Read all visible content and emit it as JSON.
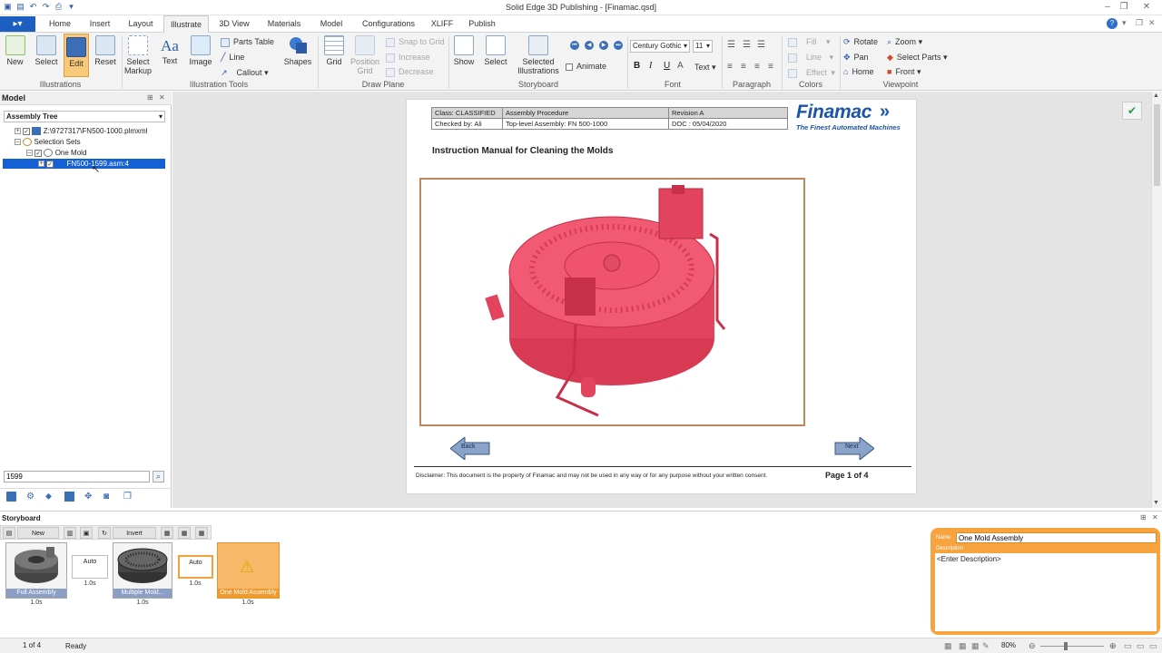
{
  "window": {
    "title": "Solid Edge 3D Publishing - [Finamac.qsd]"
  },
  "tabs": [
    "Home",
    "Insert",
    "Layout",
    "Illustrate",
    "3D View",
    "Materials",
    "Model",
    "Configurations",
    "XLIFF",
    "Publish"
  ],
  "active_tab": "Illustrate",
  "ribbon": {
    "illustrations": {
      "group": "Illustrations",
      "new": "New",
      "select": "Select",
      "edit": "Edit",
      "reset": "Reset"
    },
    "tools": {
      "group": "Illustration Tools",
      "select_markup": "Select\nMarkup",
      "text": "Text",
      "image": "Image",
      "parts_table": "Parts Table",
      "line": "Line",
      "callout": "Callout",
      "shapes": "Shapes"
    },
    "draw_plane": {
      "group": "Draw Plane",
      "grid": "Grid",
      "position_grid": "Position\nGrid",
      "snap": "Snap to Grid",
      "increase": "Increase",
      "decrease": "Decrease"
    },
    "storyboard": {
      "group": "Storyboard",
      "show": "Show",
      "select": "Select",
      "selected_illustrations": "Selected\nIllustrations",
      "animate": "Animate"
    },
    "font": {
      "group": "Font",
      "family": "Century Gothic",
      "size": "11",
      "bold": "B",
      "italic": "I",
      "underline": "U",
      "text": "Text"
    },
    "paragraph": {
      "group": "Paragraph"
    },
    "colors": {
      "group": "Colors",
      "fill": "Fill",
      "line": "Line",
      "effect": "Effect"
    },
    "viewpoint": {
      "group": "Viewpoint",
      "rotate": "Rotate",
      "pan": "Pan",
      "home": "Home",
      "zoom": "Zoom",
      "select_parts": "Select Parts",
      "front": "Front"
    }
  },
  "model_panel": {
    "title": "Model",
    "dropdown": "Assembly Tree",
    "tree": [
      {
        "label": "Z:\\9727317\\FN500-1000.plmxml"
      },
      {
        "label": "Selection Sets"
      },
      {
        "label": "One Mold"
      },
      {
        "label": "FN500-1599.asm:4"
      }
    ],
    "search_value": "1599"
  },
  "document": {
    "header_cells": [
      [
        "Class: CLASSIFIED",
        "Assembly Procedure",
        "Revision A"
      ],
      [
        "Checked by: Ali",
        "Top-level Assembly: FN 500-1000",
        "DOC : 05/04/2020"
      ]
    ],
    "logo_name": "Finamac",
    "logo_tagline": "The Finest Automated Machines",
    "heading": "Instruction Manual for Cleaning the Molds",
    "back_label": "Back",
    "next_label": "Next",
    "disclaimer": "Disclaimer: This document is the property of Finamac and may not be used in any way or for any purpose without your written consent.",
    "page_label": "Page 1 of 4"
  },
  "storyboard": {
    "title": "Storyboard",
    "new_label": "New",
    "invert_label": "Invert",
    "items": [
      {
        "caption": "Full Assembly",
        "time": "1.0s"
      },
      {
        "transition": "Auto",
        "time": "1.0s"
      },
      {
        "caption": "Multiple Mold...",
        "time": "1.0s"
      },
      {
        "transition": "Auto",
        "time": "1.0s"
      },
      {
        "caption": "One Mold Assembly",
        "time": "1.0s"
      }
    ],
    "name_label": "Name",
    "name_value": "One Mold Assembly",
    "description_label": "Description",
    "description_value": "<Enter Description>"
  },
  "status": {
    "page": "1 of 4",
    "state": "Ready",
    "zoom": "80%"
  },
  "colors": {
    "accent": "#1c5fc0",
    "model": "#e8435c",
    "storyboard_active": "#f7a440"
  }
}
